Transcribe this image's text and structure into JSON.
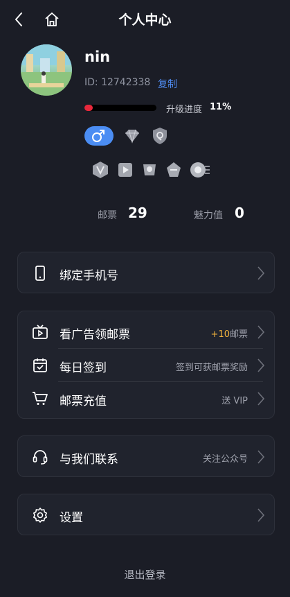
{
  "header": {
    "title": "个人中心"
  },
  "profile": {
    "username": "nin",
    "user_id": "ID: 12742338",
    "copy_label": "复制",
    "level_progress_label": "升级进度",
    "level_progress_value": "11%",
    "level_progress_fraction": 0.11
  },
  "badges": [
    "male-gender-icon",
    "diamond-icon",
    "shield-icon"
  ],
  "medals": [
    "medal-1-icon",
    "medal-2-icon",
    "medal-3-icon",
    "medal-4-icon",
    "medal-5-icon"
  ],
  "stats": {
    "stamps_label": "邮票",
    "stamps_value": "29",
    "charm_label": "魅力值",
    "charm_value": "0"
  },
  "menu": {
    "bind_phone": {
      "label": "绑定手机号"
    },
    "watch_ads": {
      "label": "看广告领邮票",
      "right_highlight": "+10",
      "right_text": "邮票"
    },
    "daily_checkin": {
      "label": "每日签到",
      "right_text": "签到可获邮票奖励"
    },
    "recharge": {
      "label": "邮票充值",
      "right_text": "送 VIP"
    },
    "contact": {
      "label": "与我们联系",
      "right_text": "关注公众号"
    },
    "settings": {
      "label": "设置"
    }
  },
  "logout": {
    "label": "退出登录"
  },
  "colors": {
    "background": "#1b1d26",
    "card": "#20232d",
    "accent_blue": "#4f8bf0",
    "progress_red": "#e8283c",
    "highlight_gold": "#f2b33d"
  }
}
